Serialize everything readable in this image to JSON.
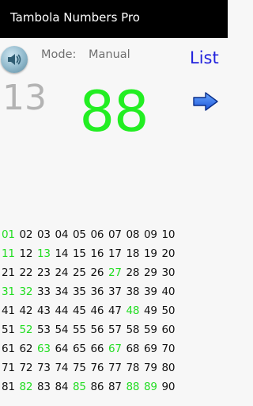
{
  "app_bar": {
    "title": "Tambola Numbers Pro"
  },
  "header": {
    "sound_icon": "speaker-icon",
    "mode_label": "Mode:",
    "mode_value": "Manual",
    "list_label": "List",
    "previous_number": "13",
    "current_number": "88",
    "next_icon": "right-arrow-icon"
  },
  "colors": {
    "called": "#22dd22",
    "uncalled": "#111111",
    "current": "#22ee22",
    "link": "#2323dd",
    "app_bar": "#000000"
  },
  "board": {
    "rows": [
      [
        "01",
        "02",
        "03",
        "04",
        "05",
        "06",
        "07",
        "08",
        "09",
        "10"
      ],
      [
        "11",
        "12",
        "13",
        "14",
        "15",
        "16",
        "17",
        "18",
        "19",
        "20"
      ],
      [
        "21",
        "22",
        "23",
        "24",
        "25",
        "26",
        "27",
        "28",
        "29",
        "30"
      ],
      [
        "31",
        "32",
        "33",
        "34",
        "35",
        "36",
        "37",
        "38",
        "39",
        "40"
      ],
      [
        "41",
        "42",
        "43",
        "44",
        "45",
        "46",
        "47",
        "48",
        "49",
        "50"
      ],
      [
        "51",
        "52",
        "53",
        "54",
        "55",
        "56",
        "57",
        "58",
        "59",
        "60"
      ],
      [
        "61",
        "62",
        "63",
        "64",
        "65",
        "66",
        "67",
        "68",
        "69",
        "70"
      ],
      [
        "71",
        "72",
        "73",
        "74",
        "75",
        "76",
        "77",
        "78",
        "79",
        "80"
      ],
      [
        "81",
        "82",
        "83",
        "84",
        "85",
        "86",
        "87",
        "88",
        "89",
        "90"
      ]
    ],
    "called": [
      "01",
      "11",
      "13",
      "27",
      "31",
      "32",
      "48",
      "52",
      "63",
      "67",
      "82",
      "85",
      "88",
      "89"
    ]
  }
}
